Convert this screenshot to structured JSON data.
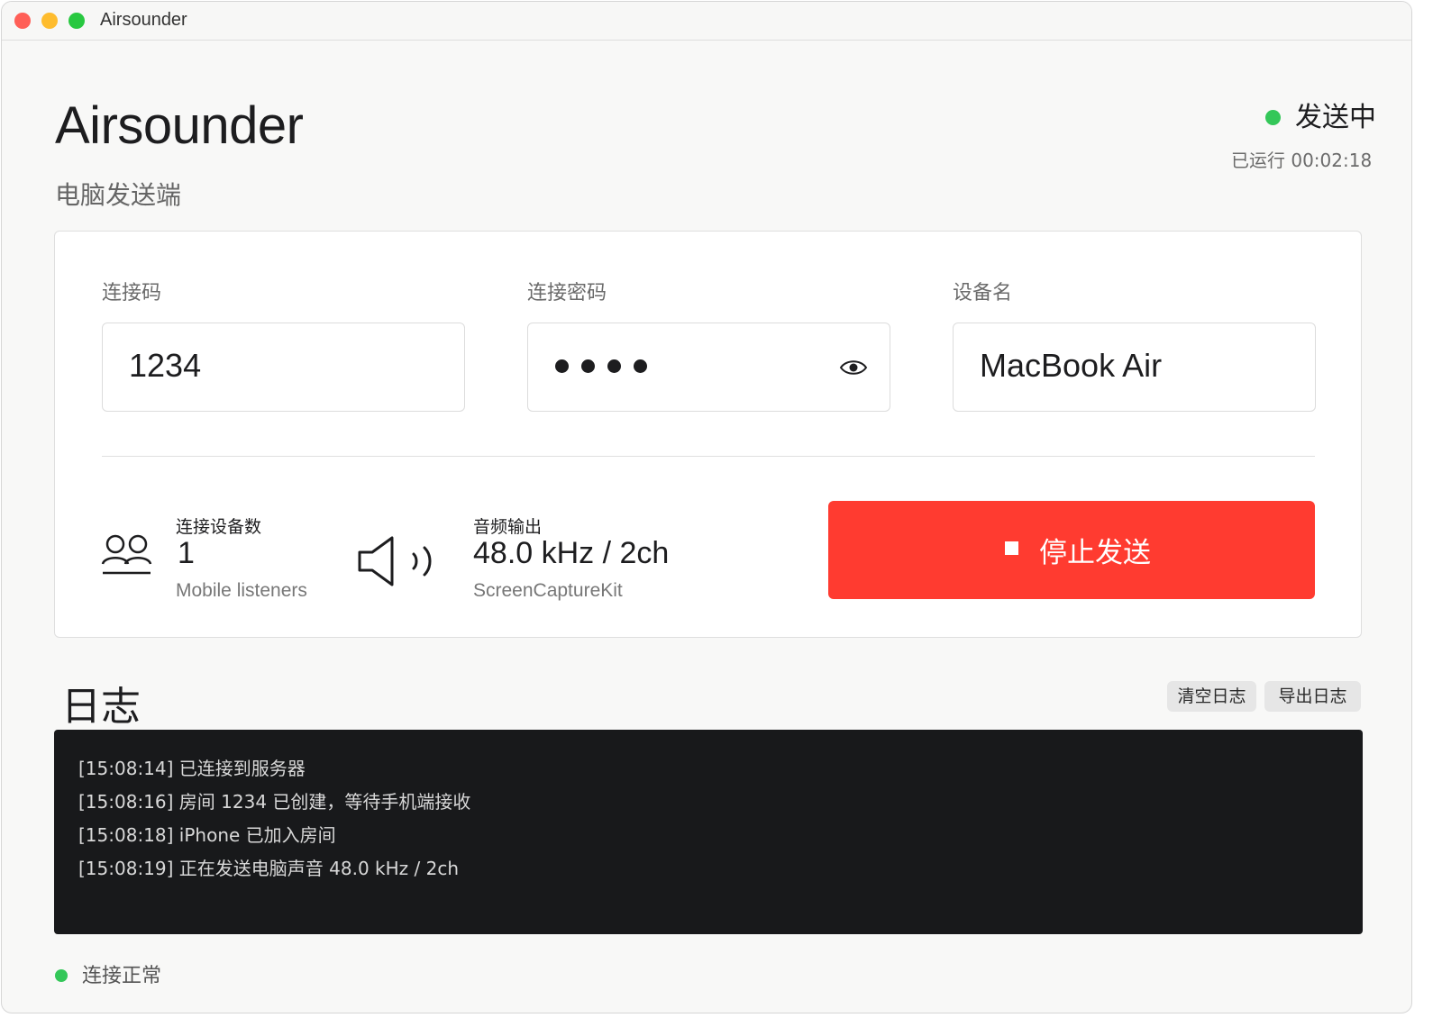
{
  "window": {
    "title": "Airsounder"
  },
  "header": {
    "app_name": "Airsounder",
    "subtitle": "电脑发送端",
    "status": "发送中",
    "uptime": "已运行 00:02:18"
  },
  "fields": [
    {
      "label": "连接码",
      "value": "1234"
    },
    {
      "label": "连接密码",
      "value": "••••",
      "masked": true
    },
    {
      "label": "设备名",
      "value": "MacBook Air"
    }
  ],
  "stats": {
    "devices": {
      "title": "连接设备数",
      "value": "1",
      "sub": "Mobile listeners",
      "icon": "users-icon"
    },
    "audio": {
      "title": "音频输出",
      "value": "48.0 kHz / 2ch",
      "sub": "ScreenCaptureKit",
      "icon": "speaker-icon"
    }
  },
  "stop_button": {
    "label": "停止发送",
    "icon": "stop-icon"
  },
  "log": {
    "title": "日志",
    "clear_label": "清空日志",
    "export_label": "导出日志",
    "lines": [
      "[15:08:14] 已连接到服务器",
      "[15:08:16] 房间 1234 已创建，等待手机端接收",
      "[15:08:18] iPhone 已加入房间",
      "[15:08:19] 正在发送电脑声音 48.0 kHz / 2ch"
    ]
  },
  "footer": {
    "status": "连接正常"
  },
  "colors": {
    "accent_red": "#ff3b30",
    "status_green": "#34c759",
    "log_background": "#18191b"
  }
}
